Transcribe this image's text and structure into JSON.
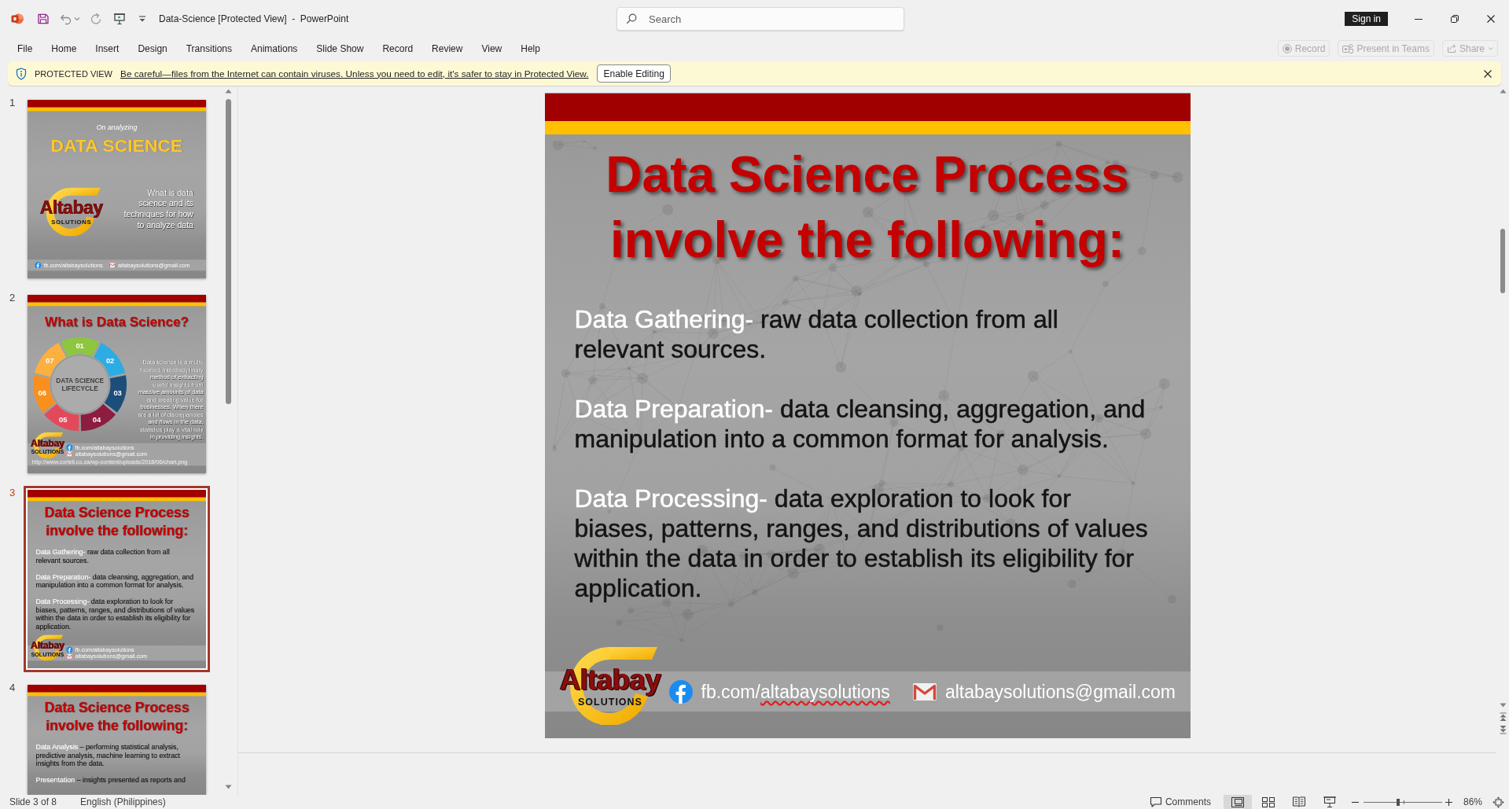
{
  "title_bar": {
    "document_title": "Data-Science [Protected View]  -  PowerPoint",
    "sign_in": "Sign in"
  },
  "search": {
    "placeholder": "Search"
  },
  "ribbon_tabs": [
    {
      "label": "File",
      "selected": false
    },
    {
      "label": "Home",
      "selected": false
    },
    {
      "label": "Insert",
      "selected": false
    },
    {
      "label": "Design",
      "selected": false
    },
    {
      "label": "Transitions",
      "selected": false
    },
    {
      "label": "Animations",
      "selected": false
    },
    {
      "label": "Slide Show",
      "selected": false
    },
    {
      "label": "Record",
      "selected": false
    },
    {
      "label": "Review",
      "selected": false
    },
    {
      "label": "View",
      "selected": false
    },
    {
      "label": "Help",
      "selected": false
    }
  ],
  "ribbon_actions": [
    {
      "kind": "record",
      "label": "Record",
      "disabled": true
    },
    {
      "kind": "teams",
      "label": "Present in Teams",
      "disabled": true
    },
    {
      "kind": "share",
      "label": "Share",
      "disabled": true
    }
  ],
  "message_bar": {
    "title": "PROTECTED VIEW",
    "message": "Be careful—files from the Internet can contain viruses. Unless you need to edit, it's safer to stay in Protected View.",
    "button": "Enable Editing"
  },
  "slides_pane": {
    "slides": [
      {
        "number": "1",
        "selected": false,
        "kind": "title",
        "tagline": "On analyzing",
        "heading": "DATA SCIENCE",
        "logo": {
          "name": "Altabay",
          "tagline": "SOLUTIONS"
        },
        "subtitle": "What is data science and its techniques for how to analyze data",
        "footer": {
          "facebook": "fb.com/altabaysolutions",
          "email": "altabaysolutions@gmail.com"
        }
      },
      {
        "number": "2",
        "selected": false,
        "kind": "lifecycle",
        "heading": "What is Data Science?",
        "lifecycle": {
          "label": "DATA SCIENCE LIFECYCLE",
          "segments": [
            {
              "number": "01",
              "color": "#8dc63f"
            },
            {
              "number": "02",
              "color": "#2cace3"
            },
            {
              "number": "03",
              "color": "#1d4e7a"
            },
            {
              "number": "04",
              "color": "#8c1d40"
            },
            {
              "number": "05",
              "color": "#e24a5c"
            },
            {
              "number": "06",
              "color": "#f7901e"
            },
            {
              "number": "07",
              "color": "#fbb040"
            }
          ]
        },
        "body": "Data science is a multi-faceted, interdisciplinary method of extracting useful insights from massive amounts of data and creating value for businesses. When there are a lot of discrepancies and flows in the data, statistics play a vital role in providing insights.",
        "footer": {
          "logo": {
            "name": "Altabay",
            "tagline": "SOLUTIONS"
          },
          "facebook": "fb.com/altabaysolutions",
          "email": "altabaysolutions@gmail.com",
          "source": "http://www.cortell.co.za/wp-content/uploads/2018/06/chart.png"
        }
      },
      {
        "number": "3",
        "selected": true,
        "kind": "bullets",
        "heading": "Data Science Process involve the following:",
        "points": [
          {
            "term": "Data Gathering-",
            "text": "raw data collection from all relevant sources."
          },
          {
            "term": "Data Preparation-",
            "text": "data cleansing, aggregation, and manipulation into a common format for analysis."
          },
          {
            "term": "Data Processing-",
            "text": "data exploration to look for biases, patterns, ranges, and distributions of values within the data in order to establish its eligibility for application."
          }
        ],
        "footer": {
          "logo": {
            "name": "Altabay",
            "tagline": "SOLUTIONS"
          },
          "facebook": "fb.com/altabaysolutions",
          "email": "altabaysolutions@gmail.com"
        }
      },
      {
        "number": "4",
        "selected": false,
        "kind": "bullets",
        "heading": "Data Science Process involve the following:",
        "points": [
          {
            "term": "Data Analysis",
            "text": "– performing statistical analysis, predictive analysis, machine learning to extract insights from the data."
          },
          {
            "term": "Presentation",
            "text": "– insights presented as reports and"
          }
        ]
      }
    ]
  },
  "editor": {
    "slide": {
      "kind": "bullets",
      "heading": "Data Science Process involve the following:",
      "points": [
        {
          "term": "Data Gathering-",
          "text": "raw data collection from all relevant sources."
        },
        {
          "term": "Data Preparation-",
          "text": "data cleansing, aggregation, and manipulation into a common format for analysis."
        },
        {
          "term": "Data Processing-",
          "text": "data exploration to look for biases, patterns, ranges, and distributions of values within the data in order to establish its eligibility for application."
        }
      ],
      "footer": {
        "logo": {
          "name": "Altabay",
          "tagline": "SOLUTIONS"
        },
        "facebook": "fb.com/altabaysolutions",
        "spelling_error": true,
        "email": "altabaysolutions@gmail.com"
      }
    }
  },
  "status_bar": {
    "slide_position": "Slide 3 of 8",
    "language": "English (Philippines)",
    "comments": "Comments",
    "views": [
      {
        "kind": "normal",
        "selected": true
      },
      {
        "kind": "sorter",
        "selected": false
      },
      {
        "kind": "reading",
        "selected": false
      },
      {
        "kind": "slideshow",
        "selected": false
      }
    ],
    "zoom": {
      "level": 0.44,
      "reading": "86%"
    }
  }
}
